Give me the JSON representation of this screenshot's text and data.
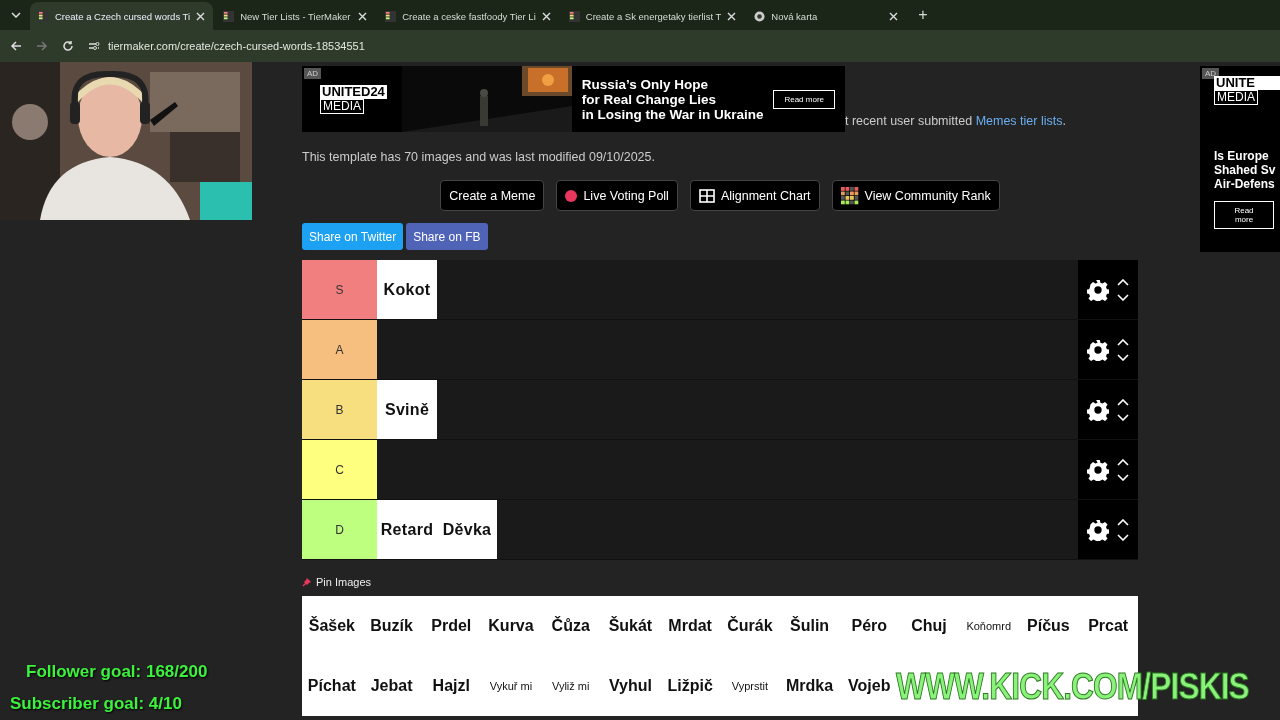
{
  "browser": {
    "tabs": [
      {
        "title": "Create a Czech cursed words Ti",
        "selected": true
      },
      {
        "title": "New Tier Lists - TierMaker",
        "selected": false
      },
      {
        "title": "Create a ceske fastfoody Tier Li",
        "selected": false
      },
      {
        "title": "Create a Sk energetaky tierlist T",
        "selected": false
      },
      {
        "title": "Nová karta",
        "selected": false,
        "kind": "chrome"
      }
    ],
    "new_tab": "+",
    "url": "tiermaker.com/create/czech-cursed-words-18534551"
  },
  "stream_overlay": {
    "follower_goal": "Follower goal: 168/200",
    "subscriber_goal": "Subscriber goal: 4/10",
    "watermark": "WWW.KICK.COM/PISKIS"
  },
  "ad_banner": {
    "badge": "AD",
    "brand": "UNITED24",
    "brand_sub": "MEDIA",
    "headline": [
      "Russia’s Only Hope",
      "for Real Change Lies",
      "in Losing the War in Ukraine"
    ],
    "button": "Read more"
  },
  "side_ad": {
    "badge": "AD",
    "brand": "UNITE",
    "brand_sub": "MEDIA",
    "headline": [
      "Is Europe",
      "Shahed Sv",
      "Air-Defens"
    ],
    "button": "Read more"
  },
  "intro": {
    "text": "t recent user submitted",
    "link": "Memes tier lists",
    "after": "."
  },
  "template_info": "This template has 70 images and was last modified 09/10/2025.",
  "actions": [
    {
      "label": "Create a Meme",
      "kind": "plain"
    },
    {
      "label": "Live Voting Poll",
      "kind": "dot"
    },
    {
      "label": "Alignment Chart",
      "kind": "grid"
    },
    {
      "label": "View Community Rank",
      "kind": "rank"
    }
  ],
  "share_buttons": [
    {
      "label": "Share on Twitter",
      "kind": "twitter"
    },
    {
      "label": "Share on FB",
      "kind": "facebook"
    }
  ],
  "tiers": [
    {
      "label": "S",
      "color": "#f27f7f",
      "items": [
        "Kokot"
      ]
    },
    {
      "label": "A",
      "color": "#f7bf7f"
    },
    {
      "label": "B",
      "color": "#f7df7f",
      "items": [
        "Svině"
      ]
    },
    {
      "label": "C",
      "color": "#ffff7f"
    },
    {
      "label": "D",
      "color": "#bfff7f",
      "items": [
        "Retard",
        "Děvka"
      ]
    }
  ],
  "pin_images": "Pin Images",
  "pool": [
    {
      "text": "Šašek",
      "kind": "large"
    },
    {
      "text": "Buzík",
      "kind": "large"
    },
    {
      "text": "Prdel",
      "kind": "large"
    },
    {
      "text": "Kurva",
      "kind": "large"
    },
    {
      "text": "Čůza",
      "kind": "large"
    },
    {
      "text": "Šukát",
      "kind": "large"
    },
    {
      "text": "Mrdat",
      "kind": "large"
    },
    {
      "text": "Čurák",
      "kind": "large"
    },
    {
      "text": "Šulin",
      "kind": "large"
    },
    {
      "text": "Péro",
      "kind": "large"
    },
    {
      "text": "Chuj",
      "kind": "large"
    },
    {
      "text": "Koňomrd",
      "kind": "small"
    },
    {
      "text": "Píčus",
      "kind": "large"
    },
    {
      "text": "Prcat",
      "kind": "large"
    },
    {
      "text": "Píchat",
      "kind": "large"
    },
    {
      "text": "Jebat",
      "kind": "large"
    },
    {
      "text": "Hajzl",
      "kind": "large"
    },
    {
      "text": "Vykuř mi",
      "kind": "small"
    },
    {
      "text": "Vyliž mi",
      "kind": "small"
    },
    {
      "text": "Vyhul",
      "kind": "large"
    },
    {
      "text": "Ližpič",
      "kind": "large"
    },
    {
      "text": "Vyprstit",
      "kind": "small"
    },
    {
      "text": "Mrdka",
      "kind": "large"
    },
    {
      "text": "Vojeb",
      "kind": "large"
    }
  ]
}
